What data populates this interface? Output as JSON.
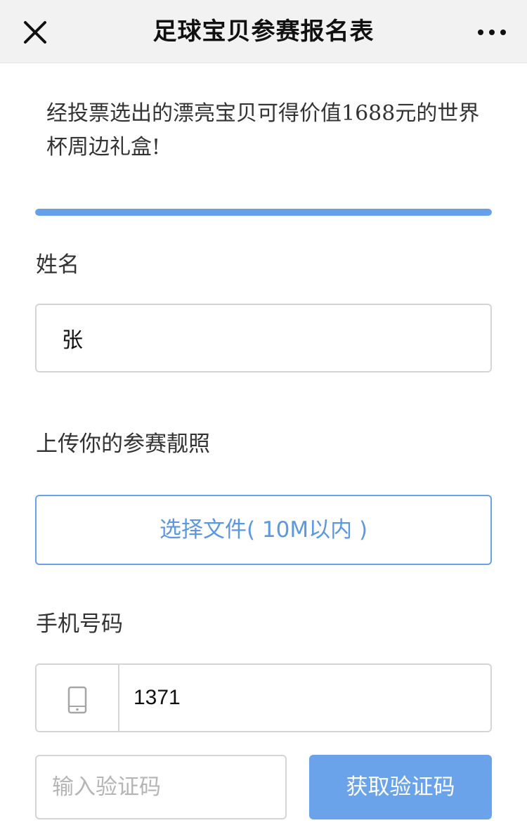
{
  "header": {
    "title": "足球宝贝参赛报名表",
    "close_icon": "close-icon",
    "more_icon": "more-dots-icon"
  },
  "intro": {
    "text": "经投票选出的漂亮宝贝可得价值1688元的世界杯周边礼盒!"
  },
  "progress": {
    "fraction": 1.0
  },
  "form": {
    "name": {
      "label": "姓名",
      "value": "张"
    },
    "photo": {
      "label": "上传你的参赛靓照",
      "button_label": "选择文件( 10M以内 )"
    },
    "phone": {
      "label": "手机号码",
      "icon": "phone-icon",
      "value": "1371"
    },
    "code": {
      "placeholder": "输入验证码",
      "value": "",
      "button_label": "获取验证码"
    }
  },
  "colors": {
    "accent": "#67a0ea",
    "nav_background": "#f2f2f2",
    "border": "#d5d5d5",
    "placeholder": "#b5b5b5"
  }
}
